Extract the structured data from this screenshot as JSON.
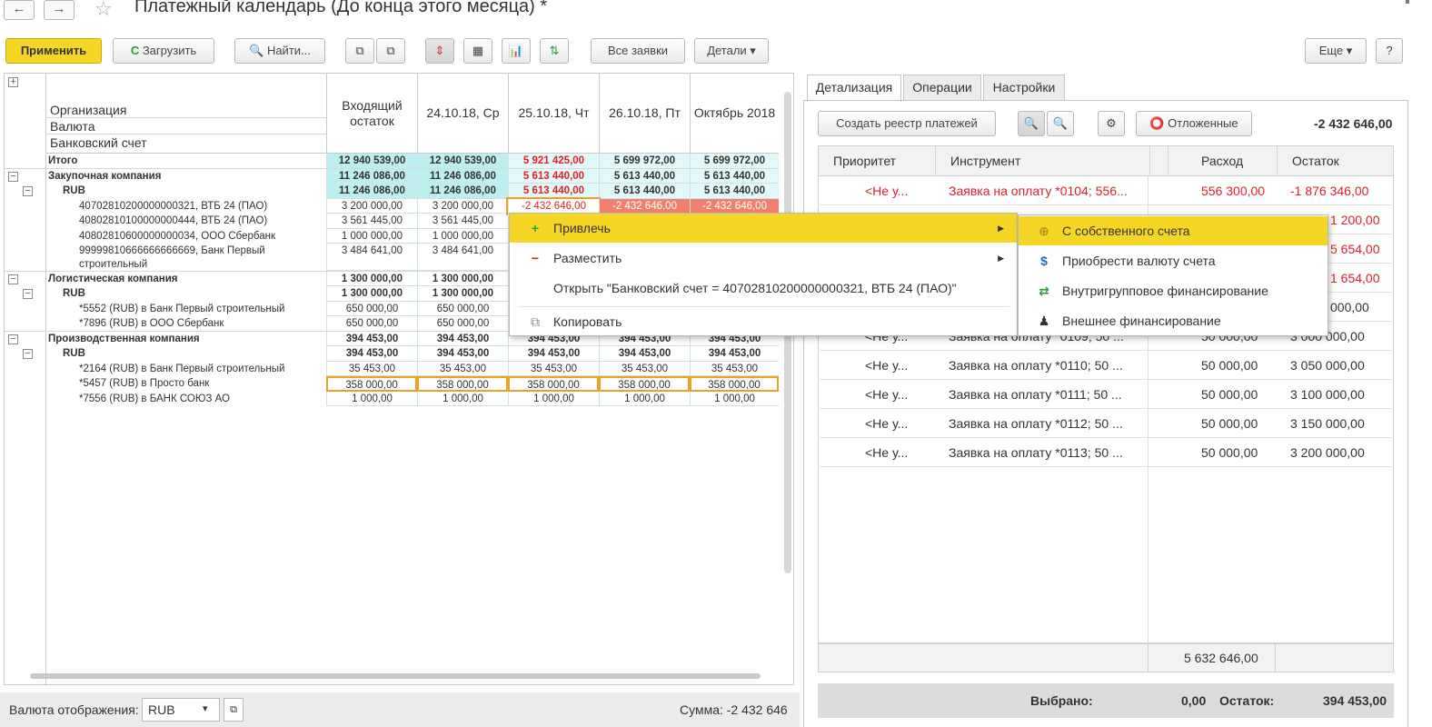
{
  "window": {
    "title": "Платежный календарь (До конца этого месяца) *",
    "back_glyph": "←",
    "forward_glyph": "→",
    "star_glyph": "☆",
    "close_glyph": "▪"
  },
  "toolbar": {
    "apply": "Применить",
    "reload": "Загрузить",
    "reload_icon_glyph": "C",
    "find": "Найти...",
    "find_icon_glyph": "🔍",
    "all_requests": "Все заявки",
    "details": "Детали ▾",
    "more": "Еще ▾",
    "help": "?",
    "icon_glyphs": [
      "⧉",
      "⧉",
      "⇕",
      "▦",
      "📊",
      "⇅"
    ]
  },
  "tree_header": [
    "Организация",
    "Валюта",
    "Банковский счет"
  ],
  "columns": [
    "Входящий\nостаток",
    "24.10.18, Ср",
    "25.10.18, Чт",
    "26.10.18, Пт",
    "Октябрь 2018"
  ],
  "rows": [
    {
      "label": "Итого",
      "bold": true,
      "values": [
        "12 940 539,00",
        "12 940 539,00",
        "5 921 425,00",
        "5 699 972,00",
        "5 699 972,00"
      ]
    },
    {
      "label": "Закупочная компания",
      "bold": true,
      "values": [
        "11 246 086,00",
        "11 246 086,00",
        "5 613 440,00",
        "5 613 440,00",
        "5 613 440,00"
      ]
    },
    {
      "label": "RUB",
      "bold": true,
      "values": [
        "11 246 086,00",
        "11 246 086,00",
        "5 613 440,00",
        "5 613 440,00",
        "5 613 440,00"
      ]
    },
    {
      "label": "40702810200000000321, ВТБ 24 (ПАО)",
      "bold": false,
      "values": [
        "3 200 000,00",
        "3 200 000,00",
        "-2 432 646,00",
        "-2 432 646,00",
        "-2 432 646,00"
      ]
    },
    {
      "label": "40802810100000000444, ВТБ 24 (ПАО)",
      "bold": false,
      "values": [
        "3 561 445,00",
        "3 561 445,00",
        "",
        "",
        ""
      ]
    },
    {
      "label": "40802810600000000034, ООО Сбербанк",
      "bold": false,
      "values": [
        "1 000 000,00",
        "1 000 000,00",
        "",
        "",
        ""
      ]
    },
    {
      "label": "99999810666666666669, Банк Первый",
      "label2": "строительный",
      "bold": false,
      "values": [
        "3 484 641,00",
        "3 484 641,00",
        "",
        "",
        ""
      ]
    },
    {
      "label": "Логистическая компания",
      "bold": true,
      "values": [
        "1 300 000,00",
        "1 300 000,00",
        "",
        "",
        ""
      ]
    },
    {
      "label": "RUB",
      "bold": true,
      "values": [
        "1 300 000,00",
        "1 300 000,00",
        "",
        "",
        ""
      ]
    },
    {
      "label": "*5552 (RUB) в Банк Первый строительный",
      "bold": false,
      "values": [
        "650 000,00",
        "650 000,00",
        "",
        "",
        ""
      ]
    },
    {
      "label": "*7896 (RUB) в ООО Сбербанк",
      "bold": false,
      "values": [
        "650 000,00",
        "650 000,00",
        "",
        "",
        ""
      ]
    },
    {
      "label": "Производственная компания",
      "bold": true,
      "values": [
        "394 453,00",
        "394 453,00",
        "394 453,00",
        "394 453,00",
        "394 453,00"
      ]
    },
    {
      "label": "RUB",
      "bold": true,
      "values": [
        "394 453,00",
        "394 453,00",
        "394 453,00",
        "394 453,00",
        "394 453,00"
      ]
    },
    {
      "label": "*2164 (RUB) в Банк Первый строительный",
      "bold": false,
      "values": [
        "35 453,00",
        "35 453,00",
        "35 453,00",
        "35 453,00",
        "35 453,00"
      ]
    },
    {
      "label": "*5457 (RUB) в Просто банк",
      "bold": false,
      "values": [
        "358 000,00",
        "358 000,00",
        "358 000,00",
        "358 000,00",
        "358 000,00"
      ]
    },
    {
      "label": "*7556 (RUB) в БАНК СОЮЗ АО",
      "bold": false,
      "values": [
        "1 000,00",
        "1 000,00",
        "1 000,00",
        "1 000,00",
        "1 000,00"
      ]
    }
  ],
  "context_menu": {
    "items": [
      {
        "icon": "+",
        "label": "Привлечь",
        "submenu": true
      },
      {
        "icon": "−",
        "label": "Разместить",
        "submenu": true
      },
      {
        "icon": "",
        "label": "Открыть \"Банковский счет = 40702810200000000321, ВТБ 24 (ПАО)\"",
        "submenu": false
      },
      {
        "icon": "⧉",
        "label": "Копировать",
        "submenu": false
      }
    ],
    "arrow_glyph": "▶"
  },
  "submenu": {
    "items": [
      {
        "icon": "⊕",
        "label": "С собственного счета"
      },
      {
        "icon": "$",
        "label": "Приобрести валюту счета"
      },
      {
        "icon": "⇄",
        "label": "Внутригрупповое финансирование"
      },
      {
        "icon": "♟",
        "label": "Внешнее финансирование"
      }
    ]
  },
  "bottom_left": {
    "currency_label": "Валюта отображения:",
    "currency_value": "RUB",
    "dropdown_glyph": "▾",
    "open_glyph": "⧉",
    "sum_text": "Сумма: -2 432 646"
  },
  "right": {
    "tabs": [
      "Детализация",
      "Операции",
      "Настройки"
    ],
    "create_registry": "Создать реестр платежей",
    "postponed": "Отложенные",
    "postponed_icon_glyph": "⭕",
    "search_icon_glyph": "🔍",
    "gear_icon_glyph": "⚙",
    "total": "-2 432 646,00",
    "grid_headers": [
      "Приоритет",
      "Инструмент",
      "Расход",
      "Остаток"
    ],
    "grid_rows": [
      {
        "priority": "<Не у...",
        "instrument": "Заявка на оплату *0104; 556...",
        "expense": "556 300,00",
        "balance": "-1 876 346,00",
        "red": true
      },
      {
        "priority": "",
        "instrument": "",
        "expense": "",
        "balance": "1 200,00",
        "red": true
      },
      {
        "priority": "",
        "instrument": "",
        "expense": "",
        "balance": "5 654,00",
        "red": true
      },
      {
        "priority": "",
        "instrument": "",
        "expense": "",
        "balance": "1 654,00",
        "red": true
      },
      {
        "priority": "",
        "instrument": "",
        "expense": "",
        "balance": "000,00",
        "red": false
      },
      {
        "priority": "<Не у...",
        "instrument": "Заявка на оплату *0109; 50 ...",
        "expense": "50 000,00",
        "balance": "3 000 000,00",
        "red": false
      },
      {
        "priority": "<Не у...",
        "instrument": "Заявка на оплату *0110; 50 ...",
        "expense": "50 000,00",
        "balance": "3 050 000,00",
        "red": false
      },
      {
        "priority": "<Не у...",
        "instrument": "Заявка на оплату *0111; 50 ...",
        "expense": "50 000,00",
        "balance": "3 100 000,00",
        "red": false
      },
      {
        "priority": "<Не у...",
        "instrument": "Заявка на оплату *0112; 50 ...",
        "expense": "50 000,00",
        "balance": "3 150 000,00",
        "red": false
      },
      {
        "priority": "<Не у...",
        "instrument": "Заявка на оплату *0113; 50 ...",
        "expense": "50 000,00",
        "balance": "3 200 000,00",
        "red": false
      }
    ],
    "footer_sum": "5 632 646,00",
    "selected_label": "Выбрано:",
    "selected_value": "0,00",
    "remainder_label": "Остаток:",
    "remainder_value": "394 453,00"
  },
  "colors": {
    "accent": "#f5d624",
    "negative": "#e0202a",
    "cyan_cell": "#bdeef0",
    "light_cyan_cell": "#e3f8f8",
    "red_cell": "#f08070",
    "orange_border": "#f0a020"
  }
}
